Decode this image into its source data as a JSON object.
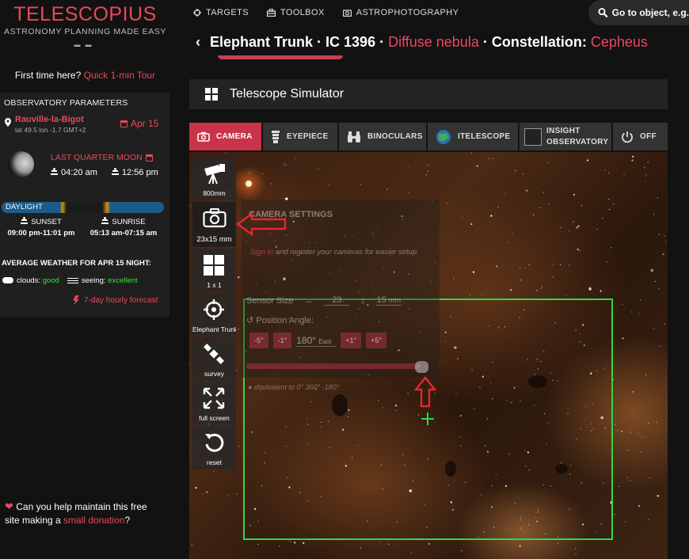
{
  "brand": {
    "title": "TELESCOPIUS",
    "subtitle": "ASTRONOMY PLANNING MADE EASY"
  },
  "first_time": {
    "text": "First time here?",
    "link": "Quick 1-min Tour"
  },
  "observatory": {
    "title": "OBSERVATORY PARAMETERS",
    "location": "Rauville-la-Bigot",
    "coords": "lat 49.5  lon -1.7  GMT+2",
    "date": "Apr 15",
    "moon": {
      "phase": "LAST QUARTER MOON",
      "rise": "04:20 am",
      "set": "12:56 pm"
    },
    "daylight_label": "DAYLIGHT",
    "sunset": {
      "label": "SUNSET",
      "time": "09:00 pm-11:01 pm"
    },
    "sunrise": {
      "label": "SUNRISE",
      "time": "05:13 am-07:15 am"
    },
    "weather_title": "AVERAGE WEATHER FOR APR 15 NIGHT:",
    "clouds_label": "clouds:",
    "clouds_value": "good",
    "seeing_label": "seeing:",
    "seeing_value": "excellent",
    "forecast": "7-day hourly forecast"
  },
  "donation": {
    "text_before": "Can you help maintain this free site making a",
    "link": "small donation",
    "text_after": "?"
  },
  "topnav": [
    {
      "label": "TARGETS",
      "icon": "crosshair-icon"
    },
    {
      "label": "TOOLBOX",
      "icon": "toolbox-icon"
    },
    {
      "label": "ASTROPHOTOGRAPHY",
      "icon": "camera-icon"
    }
  ],
  "search": {
    "label": "Go to object, e.g."
  },
  "heading": {
    "name": "Elephant Trunk",
    "sep1": " · ",
    "id": "IC 1396",
    "sep2": " · ",
    "type": "Diffuse nebula",
    "sep3": " · ",
    "const_label": "Constellation:",
    "const_value": "Cepheus"
  },
  "simulator": {
    "title": "Telescope Simulator"
  },
  "tabs": [
    {
      "label": "CAMERA",
      "active": true
    },
    {
      "label": "EYEPIECE",
      "active": false
    },
    {
      "label": "BINOCULARS",
      "active": false
    },
    {
      "label": "ITELESCOPE",
      "active": false
    },
    {
      "label": "INSIGHT OBSERVATORY",
      "active": false
    },
    {
      "label": "OFF",
      "active": false
    }
  ],
  "tools": [
    {
      "label": "800mm",
      "icon": "telescope-icon"
    },
    {
      "label": "23x15 mm",
      "icon": "camera-icon"
    },
    {
      "label": "1 x 1",
      "icon": "grid-icon"
    },
    {
      "label": "Elephant Trunk",
      "icon": "target-icon"
    },
    {
      "label": "survey",
      "icon": "satellite-icon"
    },
    {
      "label": "full screen",
      "icon": "fullscreen-icon"
    },
    {
      "label": "reset",
      "icon": "reset-icon"
    }
  ],
  "camera_settings": {
    "title": "CAMERA SETTINGS",
    "hint_link": "Sign in",
    "hint_text": "and register your cameras for easier setup.",
    "sensor_label": "Sensor Size",
    "sensor_w": "23",
    "sensor_h": "15",
    "sensor_unit": "mm",
    "pa_label": "Position Angle:",
    "pa_buttons": [
      "-5°",
      "-1°",
      "+1°",
      "+5°"
    ],
    "pa_value": "180°",
    "pa_suffix": "East",
    "equiv": "equivalent to  0° 360° -180°",
    "pa_fraction": 0.99
  },
  "colors": {
    "accent": "#e8495f",
    "fov": "#2ed84a",
    "tab_active": "#c9344a"
  }
}
